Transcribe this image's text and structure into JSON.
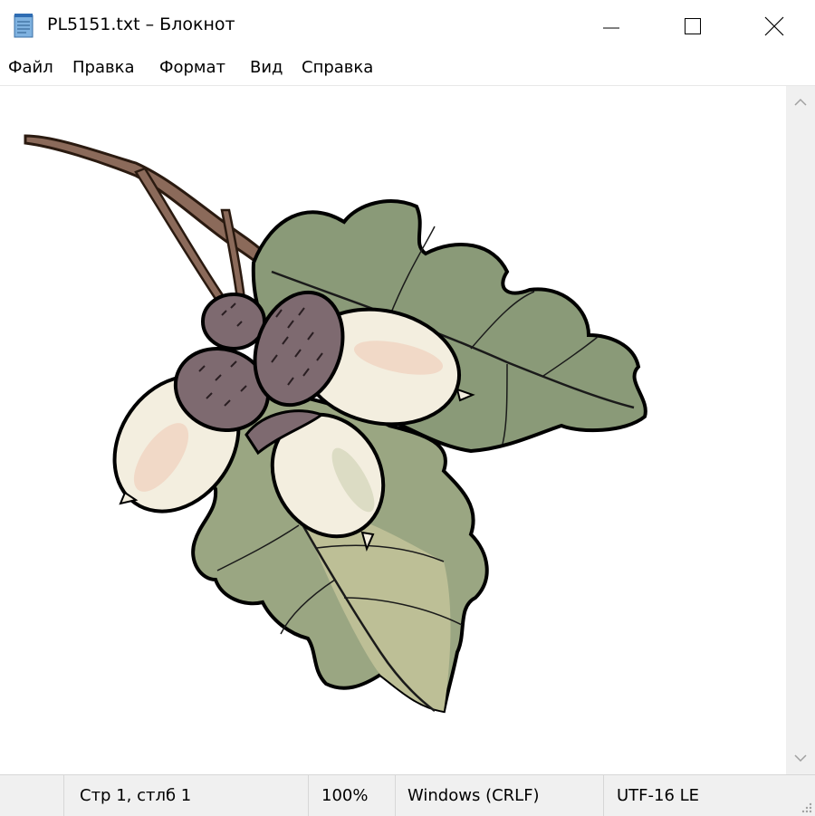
{
  "window": {
    "title": "PL5151.txt – Блокнот"
  },
  "menu": [
    "Файл",
    "Правка",
    "Формат",
    "Вид",
    "Справка"
  ],
  "status": {
    "position": "Стр 1, стлб 1",
    "zoom": "100%",
    "line_ending": "Windows (CRLF)",
    "encoding": "UTF-16 LE"
  },
  "icons": {
    "app": "notepad-icon",
    "minimize": "minimize-icon",
    "maximize": "maximize-icon",
    "close": "close-icon",
    "scroll_up": "chevron-up-icon",
    "scroll_down": "chevron-down-icon"
  },
  "colors": {
    "leaf_dark": "#8a9a78",
    "leaf_light": "#b9bc94",
    "acorn_cap": "#7e6a70",
    "acorn_nut": "#f3eedf",
    "twig": "#8b6a5a"
  }
}
